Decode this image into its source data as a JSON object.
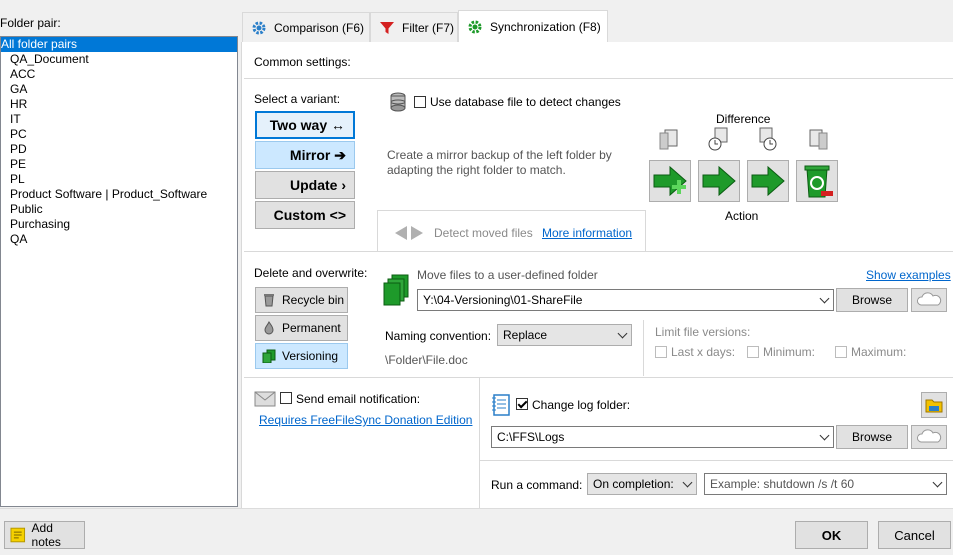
{
  "folder_pair_label": "Folder pair:",
  "folder_list": [
    "All folder pairs",
    "QA_Document",
    "ACC",
    "GA",
    "HR",
    "IT",
    "PC",
    "PD",
    "PE",
    "PL",
    "Product Software | Product_Software",
    "Public",
    "Purchasing",
    "QA"
  ],
  "tabs": {
    "comparison": "Comparison (F6)",
    "filter": "Filter (F7)",
    "sync": "Synchronization (F8)"
  },
  "common_settings": "Common settings:",
  "select_variant": "Select a variant:",
  "variants": {
    "two_way": "Two way ↔",
    "mirror": "Mirror ➔",
    "update": "Update ›",
    "custom": "Custom <>"
  },
  "use_db_label": "Use database file to detect changes",
  "mirror_desc_1": "Create a mirror backup of the left folder by",
  "mirror_desc_2": "adapting the right folder to match.",
  "difference_label": "Difference",
  "action_label": "Action",
  "detect_moved": "Detect moved files",
  "more_info": "More information",
  "delete_overwrite": "Delete and overwrite:",
  "delete_buttons": {
    "recycle": "Recycle bin",
    "permanent": "Permanent",
    "versioning": "Versioning"
  },
  "move_files_label": "Move files to a user-defined folder",
  "show_examples": "Show examples",
  "versioning_path": "Y:\\04-Versioning\\01-ShareFile",
  "browse": "Browse",
  "naming_convention_label": "Naming convention:",
  "naming_convention_value": "Replace",
  "naming_example": "\\Folder\\File.doc",
  "limit_versions": "Limit file versions:",
  "last_x_days": "Last x days:",
  "minimum": "Minimum:",
  "maximum": "Maximum:",
  "send_email": "Send email notification:",
  "donation_link": "Requires FreeFileSync Donation Edition",
  "change_log_folder": "Change log folder:",
  "log_path": "C:\\FFS\\Logs",
  "run_command_label": "Run a command:",
  "on_completion": "On completion:",
  "command_placeholder": "Example: shutdown /s /t 60",
  "add_notes": "Add notes",
  "ok": "OK",
  "cancel": "Cancel",
  "colors": {
    "selection": "#0078d7",
    "link": "#0066cc",
    "green_arrow": "#1e9a2a",
    "selected_button": "#cce8ff"
  }
}
